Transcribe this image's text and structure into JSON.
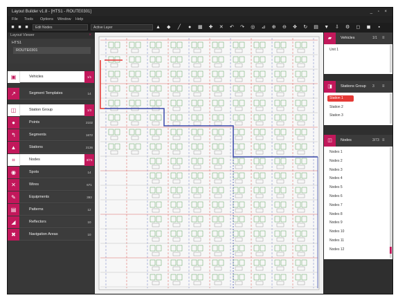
{
  "window": {
    "title": "Layout Builder v1.8 - [HTS1 - ROUTE0301]",
    "controls": "_ ▫ ×"
  },
  "menubar": [
    {
      "label": "File"
    },
    {
      "label": "Tools"
    },
    {
      "label": "Options"
    },
    {
      "label": "Window"
    },
    {
      "label": "Help"
    }
  ],
  "toolbar": {
    "mode_combo": "Edit Nodes",
    "layer_combo": "Active Layer"
  },
  "left_panel": {
    "header": "Layout Viewer",
    "tree_root": "HTS1",
    "tree_child": "ROUTE0301",
    "items": [
      {
        "label": "Vehicles",
        "count": "1/1",
        "icon": "car-icon",
        "selected": true
      },
      {
        "label": "Segment Templates",
        "count": "14",
        "icon": "curve-icon",
        "selected": false
      },
      {
        "label": "Station Group",
        "count": "1/3",
        "icon": "station-group-icon",
        "selected": true
      },
      {
        "label": "Points",
        "count": "2102",
        "icon": "point-icon",
        "selected": false
      },
      {
        "label": "Segments",
        "count": "1672",
        "icon": "segment-icon",
        "selected": false
      },
      {
        "label": "Stations",
        "count": "2136",
        "icon": "station-icon",
        "selected": false
      },
      {
        "label": "Nodes",
        "count": "3/73",
        "icon": "node-icon",
        "selected": true
      },
      {
        "label": "Spots",
        "count": "14",
        "icon": "spot-icon",
        "selected": false
      },
      {
        "label": "Wires",
        "count": "671",
        "icon": "wire-icon",
        "selected": false
      },
      {
        "label": "Equipments",
        "count": "393",
        "icon": "equipment-icon",
        "selected": false
      },
      {
        "label": "Patterns",
        "count": "12",
        "icon": "pattern-icon",
        "selected": false
      },
      {
        "label": "Reflectors",
        "count": "10",
        "icon": "reflector-icon",
        "selected": false
      },
      {
        "label": "Navigation Areas",
        "count": "10",
        "icon": "navigation-area-icon",
        "selected": false
      }
    ]
  },
  "right_panel": {
    "vehicles": {
      "title": "Vehicles",
      "count": "1/1",
      "items": [
        "Unit 1"
      ]
    },
    "station_group": {
      "title": "Stations Group",
      "count": "3",
      "items": [
        "Station 1",
        "Station 2",
        "Station 3"
      ],
      "selected_index": 0
    },
    "nodes": {
      "title": "Nodes",
      "count": "3/73",
      "items": [
        "Nodes 1",
        "Nodes 2",
        "Nodes 3",
        "Nodes 4",
        "Nodes 5",
        "Nodes 6",
        "Nodes 7",
        "Nodes 8",
        "Nodes 9",
        "Nodes 10",
        "Nodes 11",
        "Nodes 12"
      ]
    }
  },
  "colors": {
    "accent": "#c2185b",
    "highlight_red": "#e53935",
    "path_blue": "#3949ab",
    "canvas_bg": "#f1f1f1"
  }
}
